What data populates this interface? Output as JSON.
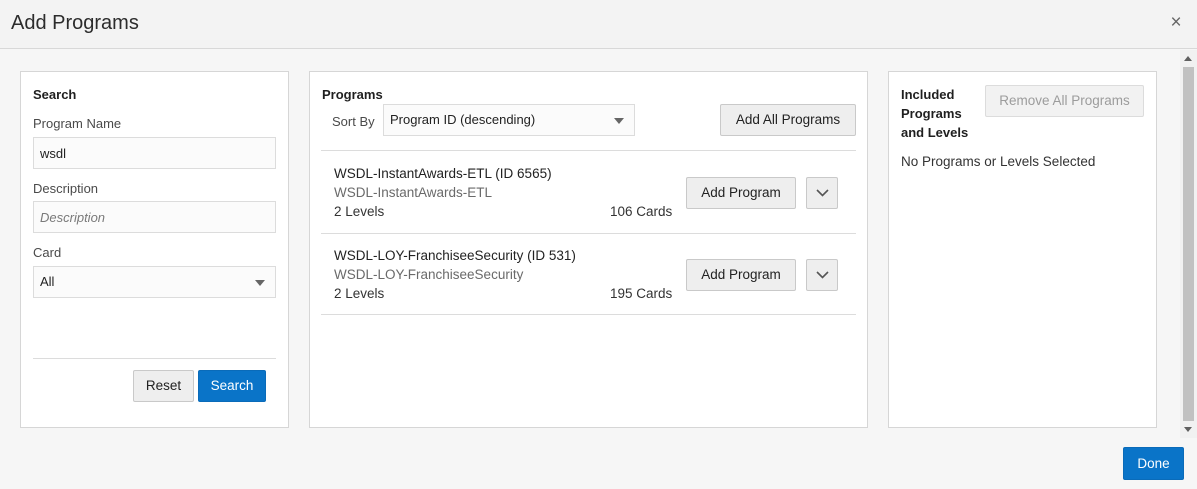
{
  "dialog": {
    "title": "Add Programs",
    "close_icon": "close-icon",
    "close_glyph": "×"
  },
  "search": {
    "heading": "Search",
    "program_name_label": "Program Name",
    "program_name_value": "wsdl",
    "description_label": "Description",
    "description_placeholder": "Description",
    "card_label": "Card",
    "card_value": "All",
    "reset_label": "Reset",
    "search_label": "Search"
  },
  "programs": {
    "heading": "Programs",
    "sort_by_label": "Sort By",
    "sort_value": "Program ID (descending)",
    "add_all_label": "Add All Programs",
    "items": [
      {
        "title": "WSDL-InstantAwards-ETL (ID 6565)",
        "subtitle": "WSDL-InstantAwards-ETL",
        "levels": "2 Levels",
        "cards": "106 Cards",
        "add_label": "Add Program"
      },
      {
        "title": "WSDL-LOY-FranchiseeSecurity (ID 531)",
        "subtitle": "WSDL-LOY-FranchiseeSecurity",
        "levels": "2 Levels",
        "cards": "195 Cards",
        "add_label": "Add Program"
      }
    ]
  },
  "included": {
    "heading_line1": "Included",
    "heading_line2": "Programs",
    "heading_line3": "and Levels",
    "remove_all_label": "Remove All Programs",
    "empty_text": "No Programs or Levels Selected"
  },
  "footer": {
    "done_label": "Done"
  },
  "colors": {
    "primary": "#0a74c8",
    "panel_border": "#d6d6d6"
  }
}
